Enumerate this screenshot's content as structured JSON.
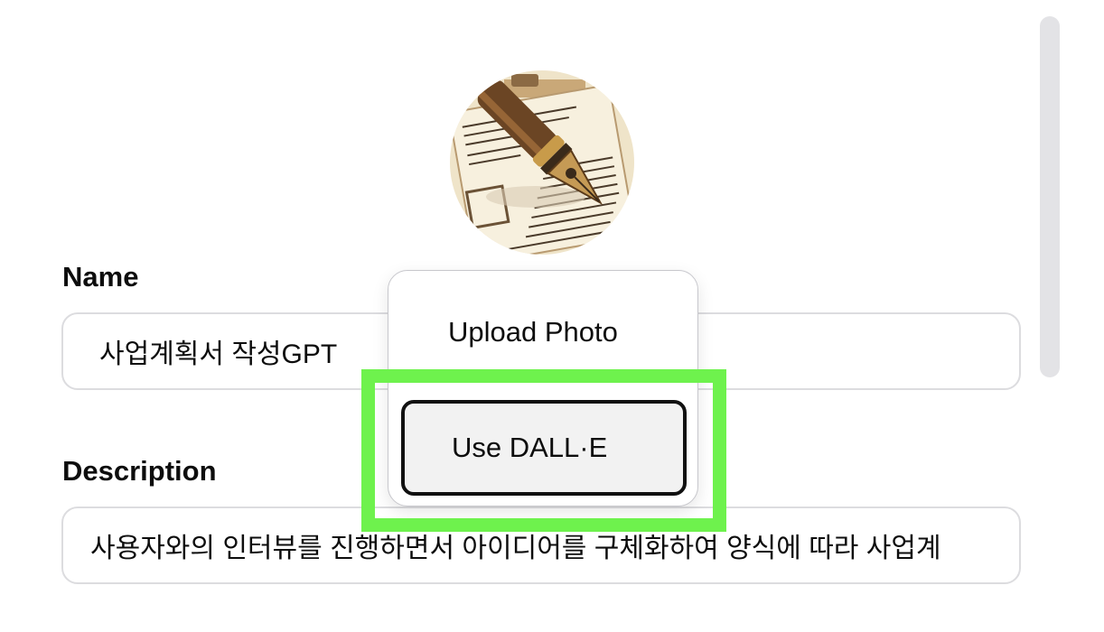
{
  "avatar": {
    "icon": "fountain-pen-icon"
  },
  "form": {
    "name_label": "Name",
    "name_value": "사업계획서 작성GPT",
    "description_label": "Description",
    "description_value": "사용자와의 인터뷰를 진행하면서 아이디어를 구체화하여 양식에 따라 사업계"
  },
  "avatar_menu": {
    "upload_label": "Upload Photo",
    "dalle_label": "Use DALL·E"
  },
  "colors": {
    "highlight": "#6ef24d",
    "scrollbar": "#e3e3e6",
    "field_border": "#dcdcdf",
    "selected_item_bg": "#f2f2f2"
  }
}
